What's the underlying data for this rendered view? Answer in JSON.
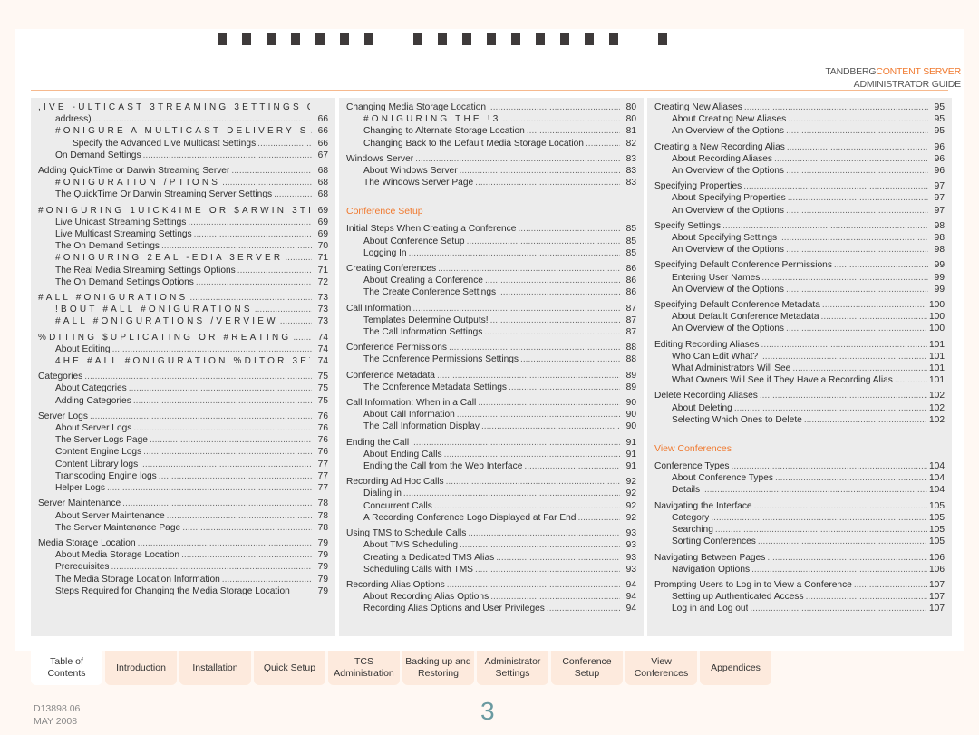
{
  "header": {
    "title_glyph_groups": [
      7,
      9,
      1
    ],
    "brand_name": "TANDBERG",
    "product": "CONTENT SERVER",
    "guide": "ADMINISTRATOR GUIDE",
    "accent_color": "#f07a30"
  },
  "col1": [
    {
      "t": ",IVE -ULTICAST 3TREAMING 3ETTINGS  C",
      "p": "",
      "lvl": 1,
      "garbled": true,
      "grp": false
    },
    {
      "t": "address)",
      "p": "66",
      "lvl": 2,
      "grp": false
    },
    {
      "t": "   #ONIGURE A MULTICAST DELIVERY  S",
      "p": "66",
      "lvl": 2,
      "garbled": true,
      "grp": false
    },
    {
      "t": "Specify the Advanced Live Multicast Settings",
      "p": "66",
      "lvl": 2,
      "grp": false,
      "extra": true
    },
    {
      "t": "On Demand Settings",
      "p": "67",
      "lvl": 2,
      "grp": false
    },
    {
      "t": "Adding QuickTime or Darwin Streaming Server",
      "p": "68",
      "lvl": 1,
      "grp": true
    },
    {
      "t": "#ONIGURATION /PTIONS",
      "p": "68",
      "lvl": 2,
      "garbled": true,
      "grp": false
    },
    {
      "t": "The QuickTime Or Darwin Streaming Server Settings",
      "p": "68",
      "lvl": 2,
      "grp": false
    },
    {
      "t": "#ONIGURING 1UICK4IME OR $ARWIN 3TR",
      "p": "69",
      "lvl": 1,
      "garbled": true,
      "grp": true
    },
    {
      "t": "Live Unicast Streaming Settings",
      "p": "69",
      "lvl": 2,
      "grp": false
    },
    {
      "t": "Live Multicast Streaming Settings",
      "p": "69",
      "lvl": 2,
      "grp": false
    },
    {
      "t": "The On Demand Settings",
      "p": "70",
      "lvl": 2,
      "grp": false
    },
    {
      "t": " #ONIGURING 2EAL -EDIA 3ERVER",
      "p": "71",
      "lvl": 2,
      "garbled": true,
      "grp": false
    },
    {
      "t": "The Real Media Streaming Settings Options",
      "p": "71",
      "lvl": 2,
      "grp": false
    },
    {
      "t": "The On Demand Settings Options",
      "p": "72",
      "lvl": 2,
      "grp": false
    },
    {
      "t": "#ALL #ONIGURATIONS",
      "p": "73",
      "lvl": 1,
      "garbled": true,
      "grp": true
    },
    {
      "t": "!BOUT #ALL #ONIGURATIONS",
      "p": "73",
      "lvl": 2,
      "garbled": true,
      "grp": false
    },
    {
      "t": "#ALL #ONIGURATIONS /VERVIEW",
      "p": "73",
      "lvl": 2,
      "garbled": true,
      "grp": false
    },
    {
      "t": "%DITING $UPLICATING OR #REATING ",
      "p": "74",
      "lvl": 1,
      "garbled": true,
      "grp": true
    },
    {
      "t": "About Editing",
      "p": "74",
      "lvl": 2,
      "grp": false
    },
    {
      "t": "4HE #ALL #ONIGURATION %DITOR 3ETT",
      "p": "74",
      "lvl": 2,
      "garbled": true,
      "grp": false
    },
    {
      "t": "Categories",
      "p": "75",
      "lvl": 1,
      "grp": true
    },
    {
      "t": "About Categories",
      "p": "75",
      "lvl": 2,
      "grp": false
    },
    {
      "t": "Adding Categories",
      "p": "75",
      "lvl": 2,
      "grp": false
    },
    {
      "t": "Server Logs",
      "p": "76",
      "lvl": 1,
      "grp": true
    },
    {
      "t": "About Server Logs",
      "p": "76",
      "lvl": 2,
      "grp": false
    },
    {
      "t": "The Server Logs Page",
      "p": "76",
      "lvl": 2,
      "grp": false
    },
    {
      "t": "Content Engine Logs",
      "p": "76",
      "lvl": 2,
      "grp": false
    },
    {
      "t": "Content Library logs",
      "p": "77",
      "lvl": 2,
      "grp": false
    },
    {
      "t": "Transcoding Engine logs",
      "p": "77",
      "lvl": 2,
      "grp": false
    },
    {
      "t": "Helper Logs",
      "p": "77",
      "lvl": 2,
      "grp": false
    },
    {
      "t": "Server Maintenance",
      "p": "78",
      "lvl": 1,
      "grp": true
    },
    {
      "t": "About Server Maintenance",
      "p": "78",
      "lvl": 2,
      "grp": false
    },
    {
      "t": "The Server Maintenance Page",
      "p": "78",
      "lvl": 2,
      "grp": false
    },
    {
      "t": "Media Storage Location",
      "p": "79",
      "lvl": 1,
      "grp": true
    },
    {
      "t": "About Media Storage Location",
      "p": "79",
      "lvl": 2,
      "grp": false
    },
    {
      "t": "Prerequisites",
      "p": "79",
      "lvl": 2,
      "grp": false
    },
    {
      "t": "The Media Storage Location Information",
      "p": "79",
      "lvl": 2,
      "grp": false
    },
    {
      "t": "Steps Required for Changing the Media Storage Location",
      "p": "79",
      "lvl": 2,
      "grp": false,
      "nodots": true
    }
  ],
  "col2": [
    {
      "t": "Changing Media Storage Location",
      "p": "80",
      "lvl": 1,
      "grp": false
    },
    {
      "t": "#ONIGURING THE !3",
      "p": "80",
      "lvl": 2,
      "garbled": true,
      "grp": false
    },
    {
      "t": "Changing to Alternate Storage Location",
      "p": "81",
      "lvl": 2,
      "grp": false
    },
    {
      "t": "Changing Back to the Default Media Storage Location",
      "p": "82",
      "lvl": 2,
      "grp": false
    },
    {
      "t": "Windows Server",
      "p": "83",
      "lvl": 1,
      "grp": true
    },
    {
      "t": "About Windows Server",
      "p": "83",
      "lvl": 2,
      "grp": false
    },
    {
      "t": "The Windows Server Page",
      "p": "83",
      "lvl": 2,
      "grp": false
    },
    {
      "section": "Conference Setup"
    },
    {
      "t": "Initial Steps When Creating a Conference",
      "p": "85",
      "lvl": 1,
      "grp": false
    },
    {
      "t": "About Conference Setup",
      "p": "85",
      "lvl": 2,
      "grp": false
    },
    {
      "t": "Logging In",
      "p": "85",
      "lvl": 2,
      "grp": false
    },
    {
      "t": "Creating Conferences",
      "p": "86",
      "lvl": 1,
      "grp": true
    },
    {
      "t": "About Creating a Conference",
      "p": "86",
      "lvl": 2,
      "grp": false
    },
    {
      "t": "The Create Conference Settings",
      "p": "86",
      "lvl": 2,
      "grp": false
    },
    {
      "t": "Call Information",
      "p": "87",
      "lvl": 1,
      "grp": true
    },
    {
      "t": "Templates Determine Outputs!",
      "p": "87",
      "lvl": 2,
      "grp": false
    },
    {
      "t": "The Call Information Settings",
      "p": "87",
      "lvl": 2,
      "grp": false
    },
    {
      "t": "Conference Permissions",
      "p": "88",
      "lvl": 1,
      "grp": true
    },
    {
      "t": "The Conference Permissions Settings",
      "p": "88",
      "lvl": 2,
      "grp": false
    },
    {
      "t": "Conference Metadata",
      "p": "89",
      "lvl": 1,
      "grp": true
    },
    {
      "t": "The Conference Metadata Settings",
      "p": "89",
      "lvl": 2,
      "grp": false
    },
    {
      "t": "Call Information: When in a Call",
      "p": "90",
      "lvl": 1,
      "grp": true
    },
    {
      "t": "About Call Information",
      "p": "90",
      "lvl": 2,
      "grp": false
    },
    {
      "t": "The Call Information Display",
      "p": "90",
      "lvl": 2,
      "grp": false
    },
    {
      "t": "Ending the Call",
      "p": "91",
      "lvl": 1,
      "grp": true
    },
    {
      "t": "About Ending Calls",
      "p": "91",
      "lvl": 2,
      "grp": false
    },
    {
      "t": "Ending the Call from the Web Interface",
      "p": "91",
      "lvl": 2,
      "grp": false
    },
    {
      "t": "Recording Ad Hoc Calls",
      "p": "92",
      "lvl": 1,
      "grp": true
    },
    {
      "t": "Dialing in",
      "p": "92",
      "lvl": 2,
      "grp": false
    },
    {
      "t": "Concurrent Calls",
      "p": "92",
      "lvl": 2,
      "grp": false
    },
    {
      "t": "A Recording Conference Logo Displayed at Far End",
      "p": "92",
      "lvl": 2,
      "grp": false
    },
    {
      "t": "Using TMS to Schedule Calls",
      "p": "93",
      "lvl": 1,
      "grp": true
    },
    {
      "t": "About TMS Scheduling",
      "p": "93",
      "lvl": 2,
      "grp": false
    },
    {
      "t": "Creating a Dedicated TMS Alias",
      "p": "93",
      "lvl": 2,
      "grp": false
    },
    {
      "t": "Scheduling Calls with TMS",
      "p": "93",
      "lvl": 2,
      "grp": false
    },
    {
      "t": "Recording Alias Options",
      "p": "94",
      "lvl": 1,
      "grp": true
    },
    {
      "t": "About Recording Alias Options",
      "p": "94",
      "lvl": 2,
      "grp": false
    },
    {
      "t": "Recording Alias Options and User Privileges",
      "p": "94",
      "lvl": 2,
      "grp": false
    }
  ],
  "col3": [
    {
      "t": "Creating New Aliases",
      "p": "95",
      "lvl": 1,
      "grp": false
    },
    {
      "t": "About Creating New Aliases",
      "p": "95",
      "lvl": 2,
      "grp": false
    },
    {
      "t": "An Overview of the Options",
      "p": "95",
      "lvl": 2,
      "grp": false
    },
    {
      "t": "Creating a New Recording Alias",
      "p": "96",
      "lvl": 1,
      "grp": true
    },
    {
      "t": "About Recording Aliases",
      "p": "96",
      "lvl": 2,
      "grp": false
    },
    {
      "t": "An Overview of the Options",
      "p": "96",
      "lvl": 2,
      "grp": false
    },
    {
      "t": "Specifying Properties",
      "p": "97",
      "lvl": 1,
      "grp": true
    },
    {
      "t": "About Specifying Properties",
      "p": "97",
      "lvl": 2,
      "grp": false
    },
    {
      "t": "An Overview of the Options",
      "p": "97",
      "lvl": 2,
      "grp": false
    },
    {
      "t": "Specify Settings",
      "p": "98",
      "lvl": 1,
      "grp": true
    },
    {
      "t": "About Specifying Settings",
      "p": "98",
      "lvl": 2,
      "grp": false
    },
    {
      "t": "An Overview of the Options",
      "p": "98",
      "lvl": 2,
      "grp": false
    },
    {
      "t": "Specifying Default Conference Permissions",
      "p": "99",
      "lvl": 1,
      "grp": true
    },
    {
      "t": "Entering User Names",
      "p": "99",
      "lvl": 2,
      "grp": false
    },
    {
      "t": "An Overview of the Options",
      "p": "99",
      "lvl": 2,
      "grp": false
    },
    {
      "t": "Specifying Default Conference Metadata",
      "p": "100",
      "lvl": 1,
      "grp": true
    },
    {
      "t": "About Default Conference Metadata",
      "p": "100",
      "lvl": 2,
      "grp": false
    },
    {
      "t": "An Overview of the Options",
      "p": "100",
      "lvl": 2,
      "grp": false
    },
    {
      "t": "Editing Recording Aliases",
      "p": "101",
      "lvl": 1,
      "grp": true
    },
    {
      "t": "Who Can Edit What?",
      "p": "101",
      "lvl": 2,
      "grp": false
    },
    {
      "t": "What Administrators Will See",
      "p": "101",
      "lvl": 2,
      "grp": false
    },
    {
      "t": "What Owners Will See if They Have a Recording Alias",
      "p": "101",
      "lvl": 2,
      "grp": false
    },
    {
      "t": "Delete Recording Aliases",
      "p": "102",
      "lvl": 1,
      "grp": true
    },
    {
      "t": "About Deleting",
      "p": "102",
      "lvl": 2,
      "grp": false
    },
    {
      "t": "Selecting Which Ones to Delete",
      "p": "102",
      "lvl": 2,
      "grp": false
    },
    {
      "section": "View Conferences"
    },
    {
      "t": "Conference Types",
      "p": "104",
      "lvl": 1,
      "grp": false
    },
    {
      "t": "About Conference Types",
      "p": "104",
      "lvl": 2,
      "grp": false
    },
    {
      "t": "Details",
      "p": "104",
      "lvl": 2,
      "grp": false
    },
    {
      "t": "Navigating the Interface",
      "p": "105",
      "lvl": 1,
      "grp": true
    },
    {
      "t": "Category",
      "p": "105",
      "lvl": 2,
      "grp": false
    },
    {
      "t": "Searching",
      "p": "105",
      "lvl": 2,
      "grp": false
    },
    {
      "t": "Sorting Conferences",
      "p": "105",
      "lvl": 2,
      "grp": false
    },
    {
      "t": "Navigating Between Pages",
      "p": "106",
      "lvl": 1,
      "grp": true
    },
    {
      "t": "Navigation Options",
      "p": "106",
      "lvl": 2,
      "grp": false
    },
    {
      "t": "Prompting Users to Log in to View a Conference",
      "p": "107",
      "lvl": 1,
      "grp": true
    },
    {
      "t": "Setting up Authenticated Access",
      "p": "107",
      "lvl": 2,
      "grp": false
    },
    {
      "t": "Log in and Log out",
      "p": "107",
      "lvl": 2,
      "grp": false
    }
  ],
  "tabs": [
    {
      "label": "Table of\nContents",
      "active": true
    },
    {
      "label": "Introduction",
      "active": false
    },
    {
      "label": "Installation",
      "active": false
    },
    {
      "label": "Quick Setup",
      "active": false
    },
    {
      "label": "TCS\nAdministration",
      "active": false
    },
    {
      "label": "Backing up and\nRestoring",
      "active": false
    },
    {
      "label": "Administrator\nSettings",
      "active": false
    },
    {
      "label": "Conference\nSetup",
      "active": false
    },
    {
      "label": "View\nConferences",
      "active": false
    },
    {
      "label": "Appendices",
      "active": false
    }
  ],
  "footer": {
    "doc_number": "D13898.06",
    "date": "MAY 2008",
    "page_number": "3"
  }
}
